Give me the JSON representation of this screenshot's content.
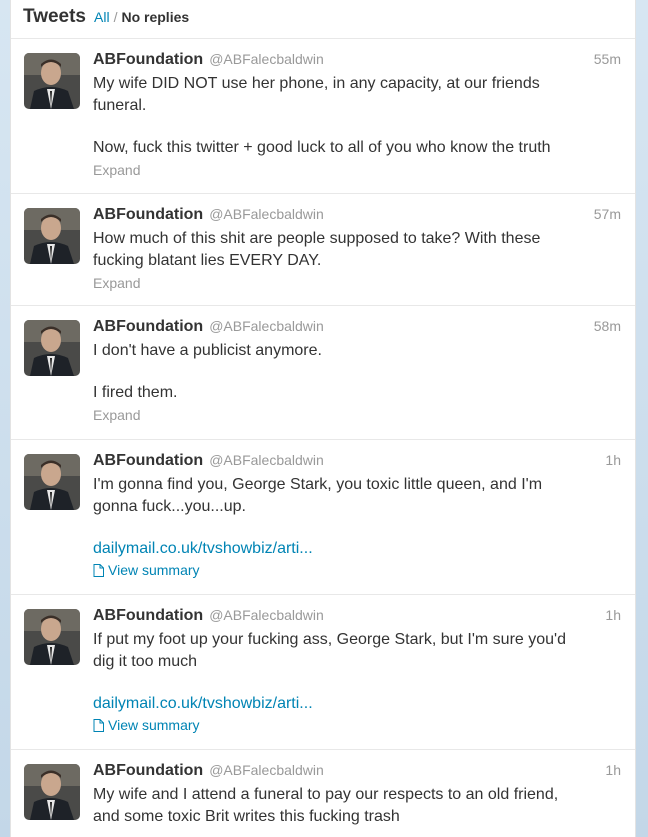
{
  "header": {
    "title": "Tweets",
    "filter_all": "All",
    "filter_sep": "/",
    "filter_no_replies": "No replies"
  },
  "tweets": [
    {
      "name": "ABFoundation",
      "handle": "@ABFalecbaldwin",
      "time": "55m",
      "para1": "My wife DID NOT use her phone, in any capacity, at our friends\nfuneral.",
      "para2": "Now, fuck this twitter + good luck to all of you who know the truth",
      "expand": "Expand"
    },
    {
      "name": "ABFoundation",
      "handle": "@ABFalecbaldwin",
      "time": "57m",
      "para1": "How much of this shit are people supposed to take? With these\nfucking blatant lies EVERY DAY.",
      "expand": "Expand"
    },
    {
      "name": "ABFoundation",
      "handle": "@ABFalecbaldwin",
      "time": "58m",
      "para1": "I don't have a publicist anymore.",
      "para2": "I fired them.",
      "expand": "Expand"
    },
    {
      "name": "ABFoundation",
      "handle": "@ABFalecbaldwin",
      "time": "1h",
      "para1": "I'm gonna find you, George Stark, you toxic little queen, and I'm\ngonna fuck...you...up.",
      "link": "dailymail.co.uk/tvshowbiz/arti...",
      "summary": "View summary"
    },
    {
      "name": "ABFoundation",
      "handle": "@ABFalecbaldwin",
      "time": "1h",
      "para1": "If put my foot up your fucking ass, George Stark, but I'm sure you'd\ndig it too much",
      "link": "dailymail.co.uk/tvshowbiz/arti...",
      "summary": "View summary"
    },
    {
      "name": "ABFoundation",
      "handle": "@ABFalecbaldwin",
      "time": "1h",
      "para1": "My wife and I attend a funeral to pay our respects to an old friend,\nand some toxic Brit writes this fucking trash"
    }
  ]
}
